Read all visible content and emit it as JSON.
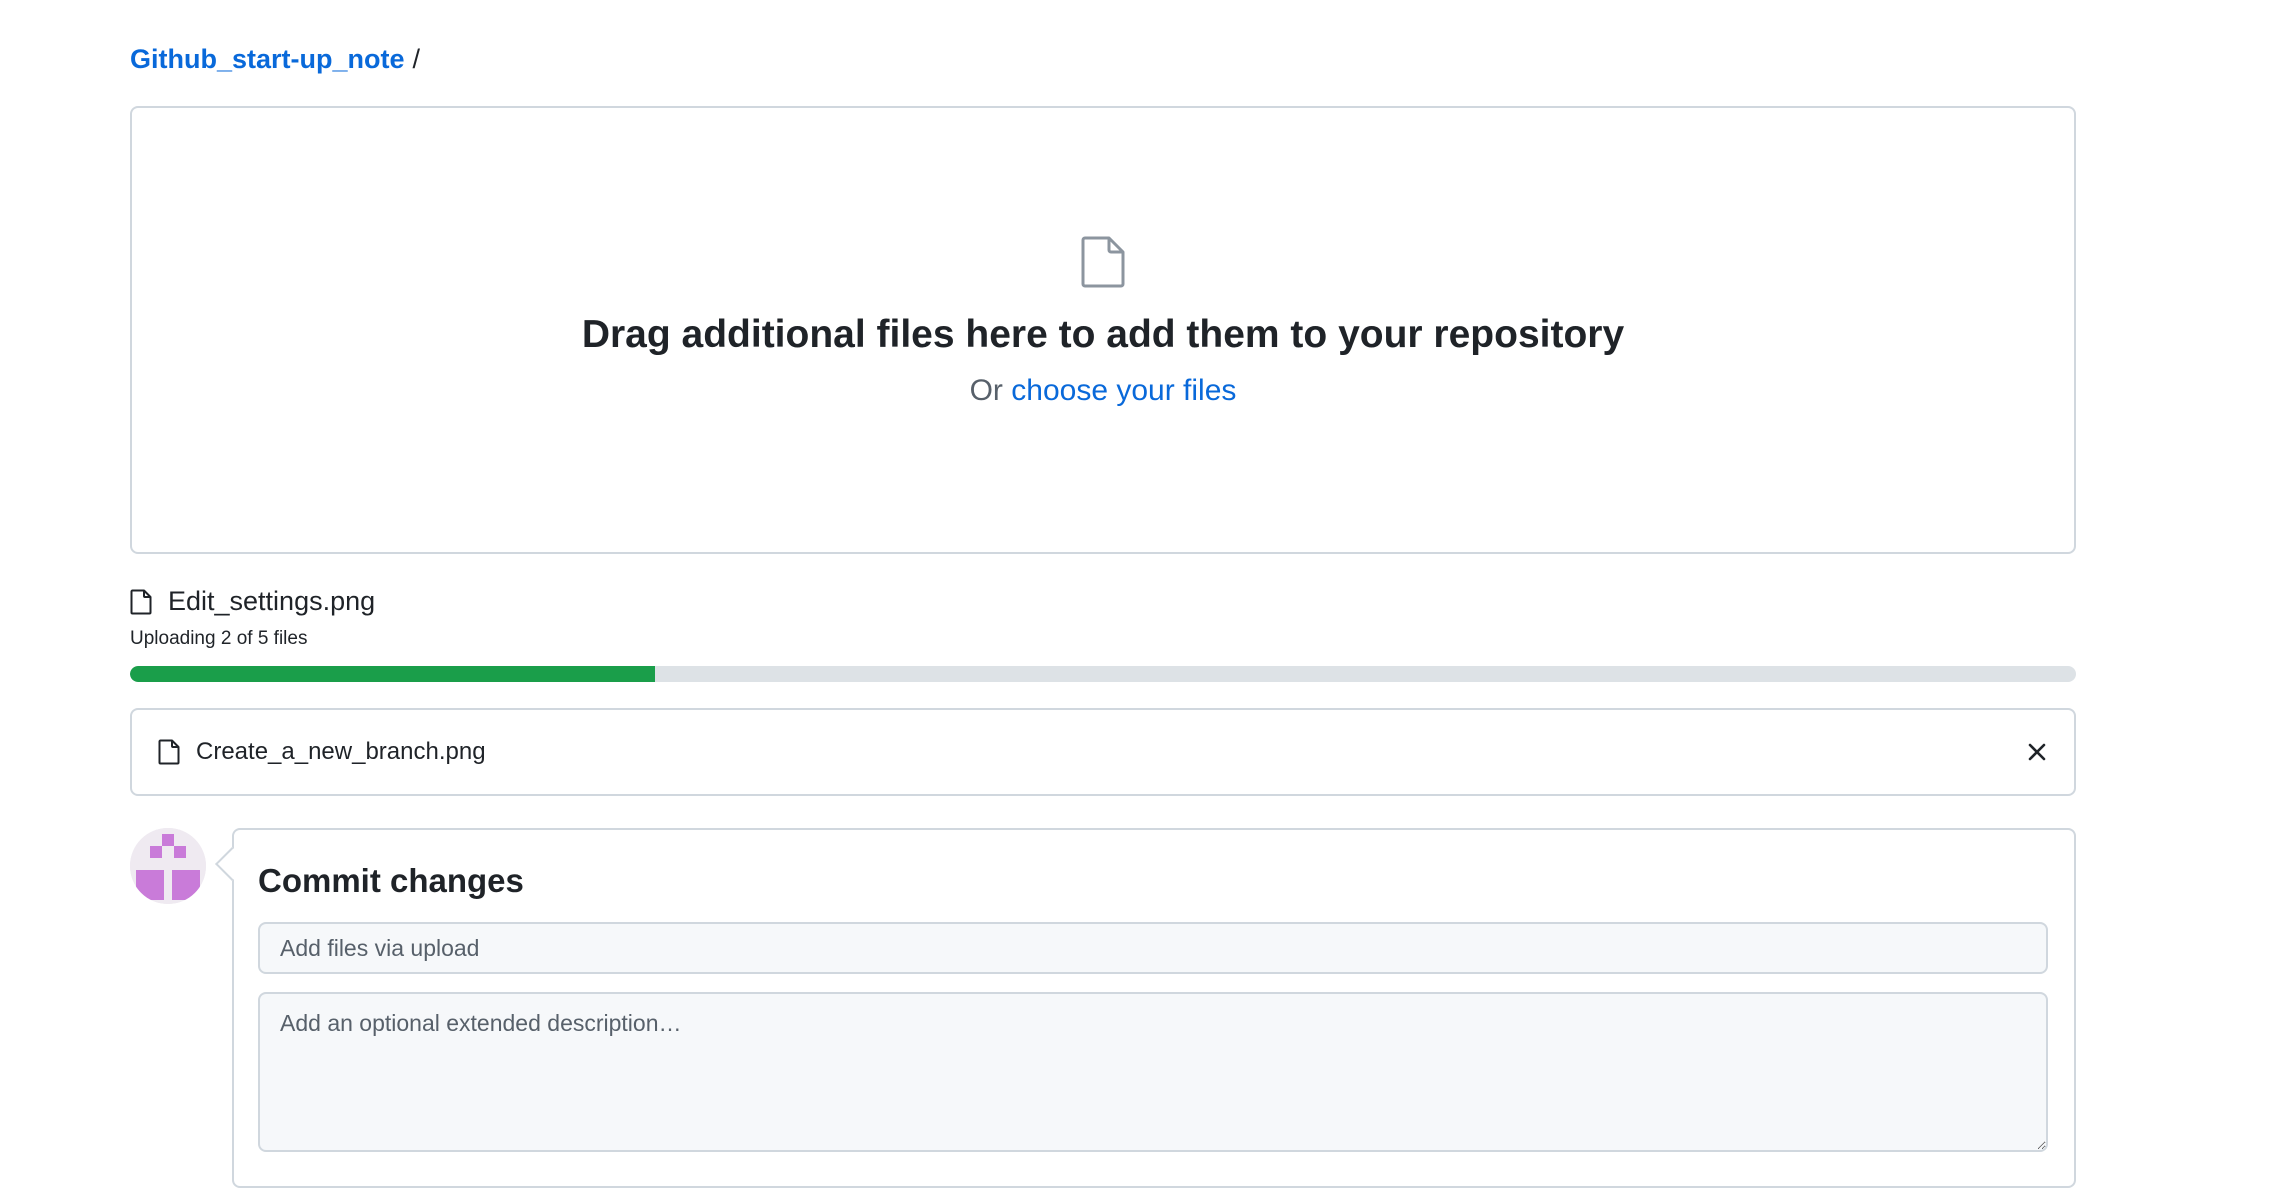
{
  "breadcrumb": {
    "repo": "Github_start-up_note",
    "separator": "/"
  },
  "dropzone": {
    "icon": "file-icon",
    "heading": "Drag additional files here to add them to your repository",
    "prefix": "Or",
    "choose_link": "choose your files"
  },
  "upload": {
    "current_file": "Edit_settings.png",
    "status": "Uploading 2 of 5 files",
    "progress_fraction": 0.27,
    "progress_color": "#1a9e4a"
  },
  "queued_files": [
    {
      "name": "Create_a_new_branch.png",
      "icon": "file-icon",
      "remove_icon": "close-icon"
    }
  ],
  "commit": {
    "title": "Commit changes",
    "summary_placeholder": "Add files via upload",
    "summary_value": "",
    "description_placeholder": "Add an optional extended description…",
    "description_value": ""
  },
  "colors": {
    "link": "#0969da",
    "border": "#d0d7de",
    "avatar": "#c97bd9"
  }
}
